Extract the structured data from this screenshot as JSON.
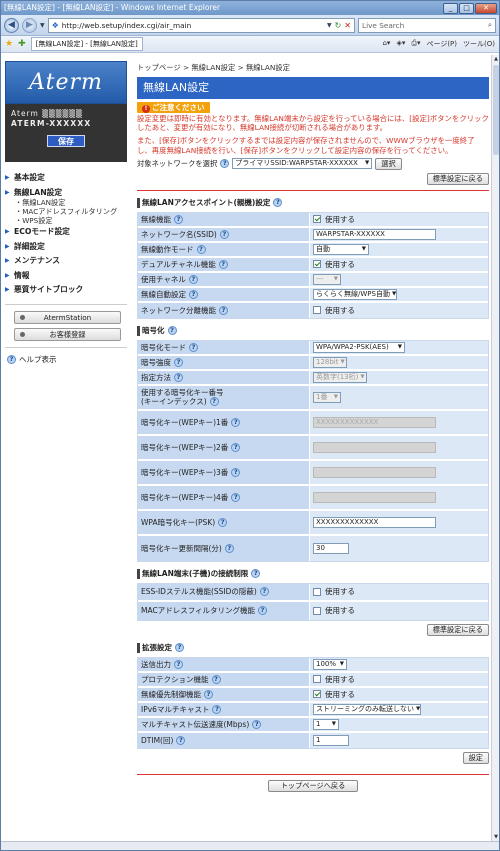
{
  "window": {
    "title": "[無線LAN設定] - [無線LAN設定] - Windows Internet Explorer",
    "min": "_",
    "max": "□",
    "close": "✕"
  },
  "addressbar": {
    "url": "http://web.setup/index.cgi/air_main",
    "search_placeholder": "Live Search"
  },
  "favbar": {
    "tab_label": "[無線LAN設定] - [無線LAN設定]",
    "page_menu": "ページ(P)",
    "tools_menu": "ツール(O)"
  },
  "sidebar": {
    "logo": "Aterm",
    "device_name": "Aterm ▒▒▒▒▒▒",
    "model": "ATERM-XXXXXX",
    "save": "保存",
    "menu": [
      {
        "label": "基本設定"
      },
      {
        "label": "無線LAN設定",
        "subs": [
          "無線LAN設定",
          "MACアドレスフィルタリング",
          "WPS設定"
        ]
      },
      {
        "label": "ECOモード設定"
      },
      {
        "label": "詳細設定"
      },
      {
        "label": "メンテナンス"
      },
      {
        "label": "情報"
      },
      {
        "label": "悪質サイトブロック"
      }
    ],
    "buttons": [
      "AtermStation",
      "お客様登録"
    ],
    "help": "ヘルプ表示"
  },
  "main": {
    "breadcrumb": "トップページ > 無線LAN設定 > 無線LAN設定",
    "title": "無線LAN設定",
    "notice_label": "ご注意ください",
    "warning1": "設定変更は即時に有効となります。無線LAN端末から設定を行っている場合には、[設定]ボタンをクリックしたあと、変更が有効になり、無線LAN接続が切断される場合があります。",
    "warning2": "また、[保存]ボタンをクリックするまでは設定内容が保存されませんので、WWWブラウザを一度終了し、再度無線LAN接続を行い、[保存]ボタンをクリックして設定内容の保存を行ってください。",
    "target_label": "対象ネットワークを選択",
    "target_value": "プライマリSSID:WARPSTAR-XXXXXX",
    "select_btn": "選択",
    "reset_btn": "標準設定に戻る",
    "ap_title": "無線LANアクセスポイント(親機)設定",
    "ap": {
      "enable_label": "無線機能",
      "enable_text": "使用する",
      "ssid_label": "ネットワーク名(SSID)",
      "ssid": "WARPSTAR-XXXXXX",
      "mode_label": "無線動作モード",
      "mode": "自動",
      "dual_label": "デュアルチャネル機能",
      "dual_text": "使用する",
      "channel_label": "使用チャネル",
      "channel": "---",
      "auto_label": "無線自動設定",
      "auto": "らくらく無線/WPS自動",
      "sep_label": "ネットワーク分離機能",
      "sep_text": "使用する"
    },
    "enc_title": "暗号化",
    "enc": {
      "mode_label": "暗号化モード",
      "mode": "WPA/WPA2-PSK(AES)",
      "strength_label": "暗号強度",
      "strength": "128bit",
      "method_label": "指定方法",
      "method": "英数字(13桁)",
      "keyidx_label1": "使用する暗号化キー番号",
      "keyidx_label2": "(キーインデックス)",
      "keyidx": "1番",
      "wep1_label": "暗号化キー(WEPキー)1番",
      "wep1": "XXXXXXXXXXXXX",
      "wep2_label": "暗号化キー(WEPキー)2番",
      "wep3_label": "暗号化キー(WEPキー)3番",
      "wep4_label": "暗号化キー(WEPキー)4番",
      "psk_label": "WPA暗号化キー(PSK)",
      "psk": "XXXXXXXXXXXXX",
      "interval_label": "暗号化キー更新間隔(分)",
      "interval": "30"
    },
    "limit_title": "無線LAN端末(子機)の接続制限",
    "limit": {
      "essid_label": "ESS-IDステルス機能(SSIDの隠蔽)",
      "essid_text": "使用する",
      "mac_label": "MACアドレスフィルタリング機能",
      "mac_text": "使用する"
    },
    "ext_title": "拡張設定",
    "ext": {
      "power_label": "送信出力",
      "power": "100%",
      "prot_label": "プロテクション機能",
      "prot_text": "使用する",
      "prio_label": "無線優先制御機能",
      "prio_text": "使用する",
      "ipv6_label": "IPv6マルチキャスト",
      "ipv6": "ストリーミングのみ転送しない",
      "rate_label": "マルチキャスト伝送速度(Mbps)",
      "rate": "1",
      "dtim_label": "DTIM(回)",
      "dtim": "1"
    },
    "set_btn": "設定",
    "top_btn": "トップページへ戻る"
  }
}
